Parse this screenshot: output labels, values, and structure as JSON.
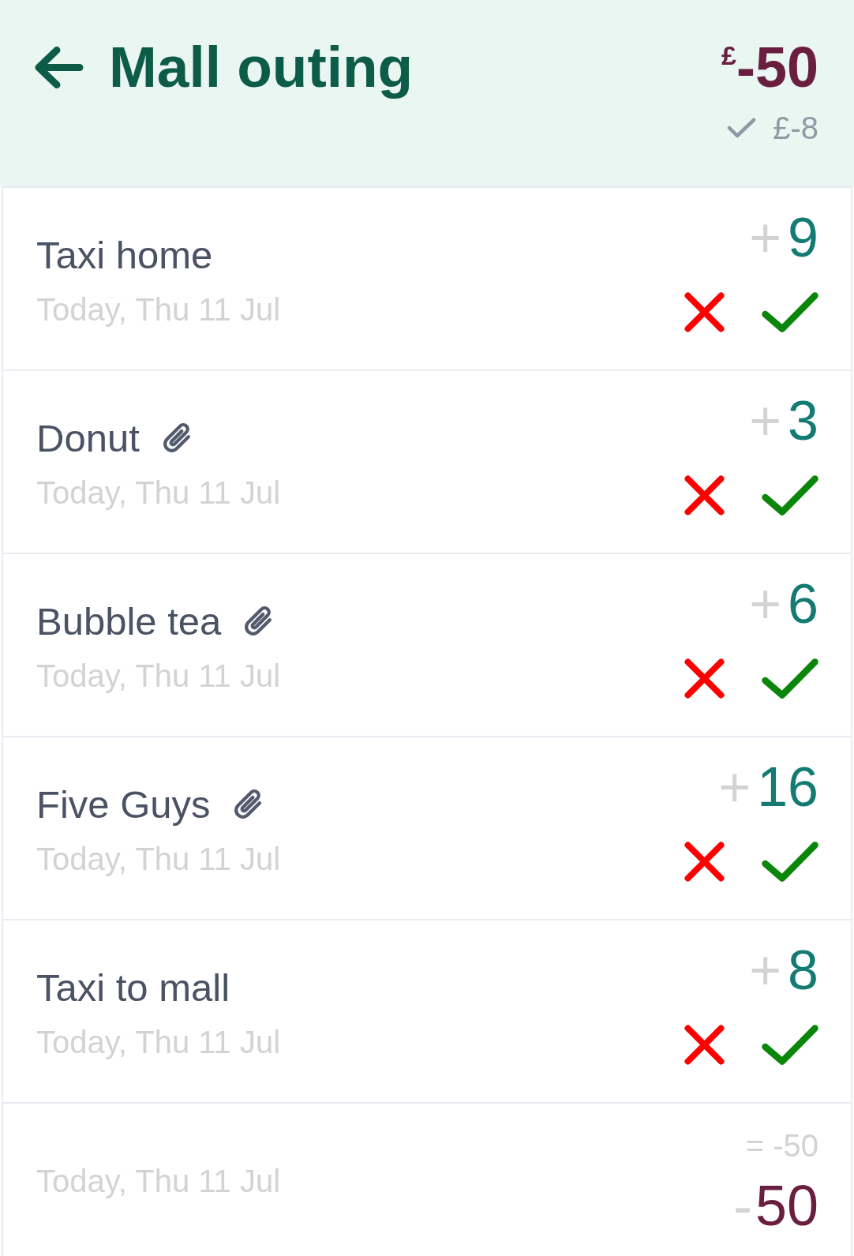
{
  "header": {
    "title": "Mall outing",
    "total": "$^{£}$-50",
    "settled": "£-8"
  },
  "transactions": [
    {
      "title": "Taxi home",
      "attachment": false,
      "date": "Today, Thu 11 Jul",
      "sign": "+",
      "amount": "9"
    },
    {
      "title": "Donut",
      "attachment": true,
      "date": "Today, Thu 11 Jul",
      "sign": "+",
      "amount": "3"
    },
    {
      "title": "Bubble tea",
      "attachment": true,
      "date": "Today, Thu 11 Jul",
      "sign": "+",
      "amount": "6"
    },
    {
      "title": "Five Guys",
      "attachment": true,
      "date": "Today, Thu 11 Jul",
      "sign": "+",
      "amount": "16"
    },
    {
      "title": "Taxi to mall",
      "attachment": false,
      "date": "Today, Thu 11 Jul",
      "sign": "+",
      "amount": "8"
    }
  ],
  "summary": {
    "date": "Today, Thu 11 Jul",
    "equation": "= -50",
    "sign": "-",
    "amount": "50"
  }
}
